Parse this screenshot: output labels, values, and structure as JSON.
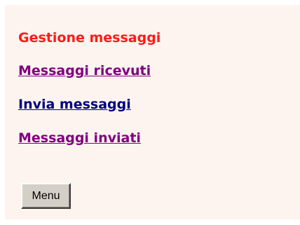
{
  "section": {
    "title": "Gestione messaggi",
    "title_color": "#ff1a1a",
    "background_color": "#fdf4ef"
  },
  "links": [
    {
      "label": "Messaggi ricevuti",
      "state": "visited",
      "color": "#800080"
    },
    {
      "label": "Invia messaggi",
      "state": "unvisited",
      "color": "#000080"
    },
    {
      "label": "Messaggi inviati",
      "state": "visited",
      "color": "#800080"
    }
  ],
  "menu_button": {
    "label": "Menu"
  }
}
